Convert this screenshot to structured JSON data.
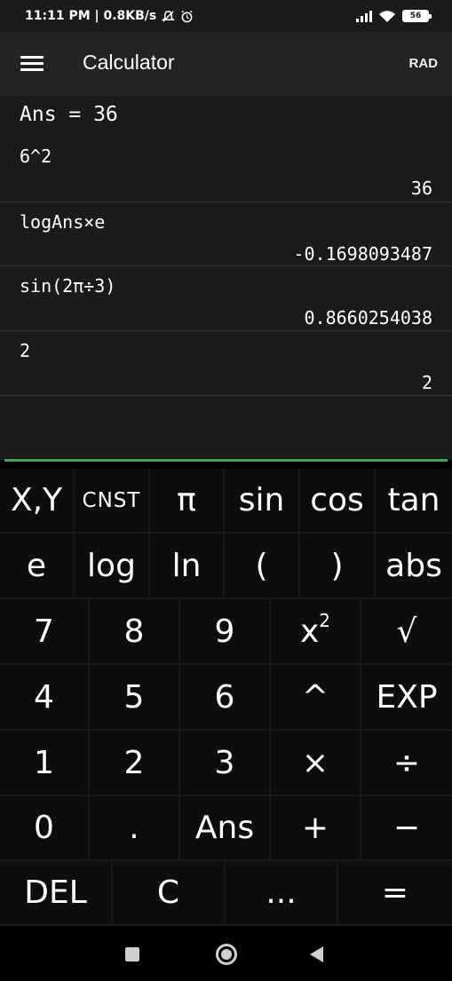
{
  "status": {
    "time_speed": "11:11 PM | 0.8KB/s",
    "battery": "56"
  },
  "app": {
    "title": "Calculator",
    "angle_mode": "RAD"
  },
  "history": {
    "ans_line": "Ans = 36",
    "entries": [
      {
        "expr": "6^2",
        "result": "36"
      },
      {
        "expr": "logAns×e",
        "result": "-0.1698093487"
      },
      {
        "expr": "sin(2π÷3)",
        "result": "0.8660254038"
      },
      {
        "expr": "2",
        "result": "2"
      }
    ]
  },
  "keys": {
    "row1": [
      "X,Y",
      "CNST",
      "π",
      "sin",
      "cos",
      "tan"
    ],
    "row2": [
      "e",
      "log",
      "ln",
      "(",
      ")",
      "abs"
    ],
    "row3": [
      "7",
      "8",
      "9",
      "x",
      "√"
    ],
    "row3_sup": "2",
    "row4": [
      "4",
      "5",
      "6",
      "^",
      "EXP"
    ],
    "row5": [
      "1",
      "2",
      "3",
      "×",
      "÷"
    ],
    "row6": [
      "0",
      ".",
      "Ans",
      "+",
      "−"
    ],
    "row7": [
      "DEL",
      "C",
      "...",
      "="
    ]
  },
  "colors": {
    "accent": "#2fb14b",
    "key_bg": "#0d0d0d",
    "history_bg": "#1b1b1b"
  }
}
